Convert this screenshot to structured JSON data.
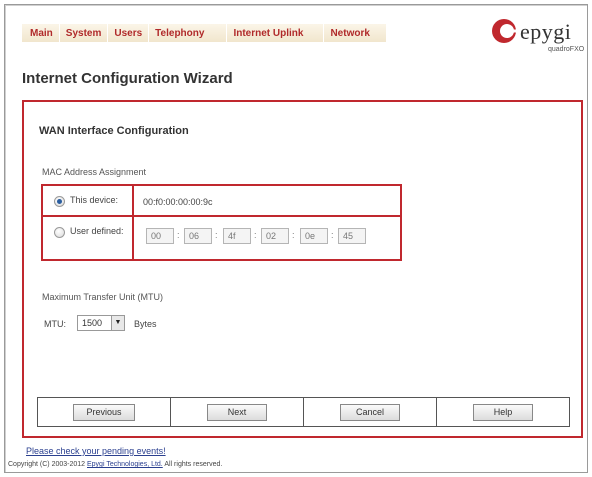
{
  "nav": {
    "items": [
      {
        "label": "Main"
      },
      {
        "label": "System"
      },
      {
        "label": "Users"
      },
      {
        "label": "Telephony"
      },
      {
        "label": "Internet Uplink"
      },
      {
        "label": "Network"
      }
    ]
  },
  "brand": {
    "name": "epygi",
    "product": "quadroFXO",
    "logo_icon": "epygi-logo-icon",
    "accent_color": "#c0282e"
  },
  "page": {
    "title": "Internet Configuration Wizard"
  },
  "wizard": {
    "section_title": "WAN Interface Configuration",
    "mac_label": "MAC Address Assignment",
    "option_this_device": "This device:",
    "this_device_mac": "00:f0:00:00:00:9c",
    "option_user_defined": "User defined:",
    "user_octets": [
      "00",
      "06",
      "4f",
      "02",
      "0e",
      "45"
    ],
    "selected_option": "This device:",
    "mtu_section_label": "Maximum Transfer Unit (MTU)",
    "mtu_label": "MTU:",
    "mtu_value": "1500",
    "mtu_unit": "Bytes"
  },
  "buttons": {
    "previous": "Previous",
    "next": "Next",
    "cancel": "Cancel",
    "help": "Help"
  },
  "footer": {
    "pending_link": "Please check your pending events!",
    "copyright_prefix": "Copyright (C) 2003-2012",
    "copyright_company": "Epygi Technologies, Ltd.",
    "copyright_suffix": "All rights reserved."
  }
}
